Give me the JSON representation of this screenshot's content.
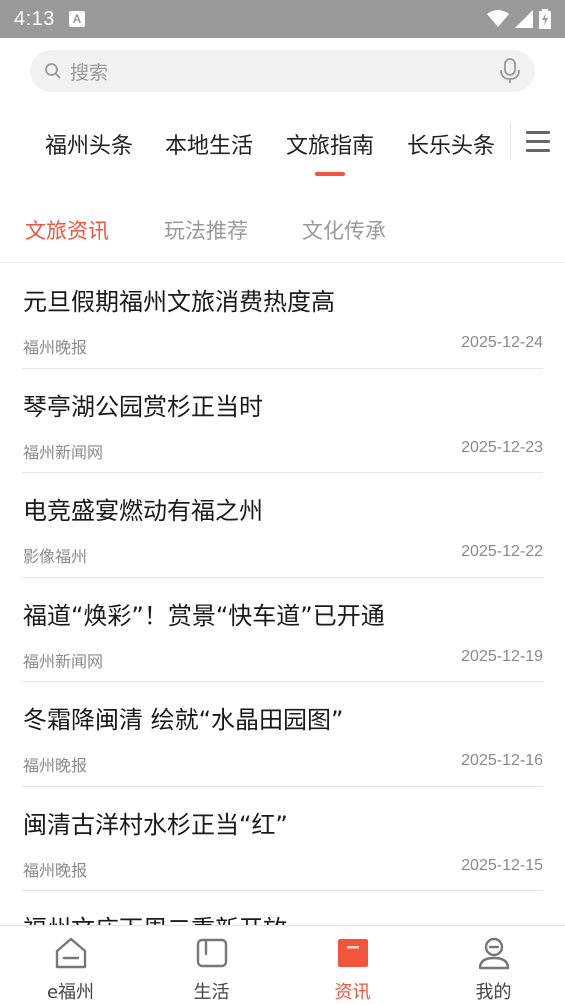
{
  "status_bar": {
    "time": "4:13",
    "notification_letter": "A"
  },
  "search": {
    "placeholder": "搜索"
  },
  "channel_tabs": {
    "items": [
      "福州头条",
      "本地生活",
      "文旅指南",
      "长乐头条"
    ],
    "active": "文旅指南"
  },
  "sub_tabs": {
    "items": [
      "文旅资讯",
      "玩法推荐",
      "文化传承"
    ],
    "active": "文旅资讯"
  },
  "news": [
    {
      "title": "元旦假期福州文旅消费热度高",
      "source": "福州晚报",
      "date": "2025-12-24"
    },
    {
      "title": "琴亭湖公园赏杉正当时",
      "source": "福州新闻网",
      "date": "2025-12-23"
    },
    {
      "title": "电竞盛宴燃动有福之州",
      "source": "影像福州",
      "date": "2025-12-22"
    },
    {
      "title": "福道“焕彩”！赏景“快车道”已开通",
      "source": "福州新闻网",
      "date": "2025-12-19"
    },
    {
      "title": "冬霜降闽清 绘就“水晶田园图”",
      "source": "福州晚报",
      "date": "2025-12-16"
    },
    {
      "title": "闽清古洋村水杉正当“红”",
      "source": "福州晚报",
      "date": "2025-12-15"
    },
    {
      "title": "福州文庙下周二重新开放",
      "source": "",
      "date": ""
    }
  ],
  "bottom_nav": {
    "items": [
      {
        "label": "e福州",
        "icon": "home-icon"
      },
      {
        "label": "生活",
        "icon": "life-icon"
      },
      {
        "label": "资讯",
        "icon": "news-icon"
      },
      {
        "label": "我的",
        "icon": "profile-icon"
      }
    ],
    "active": "资讯"
  },
  "colors": {
    "accent": "#f2553c",
    "status_bar": "#9a9a9a"
  }
}
